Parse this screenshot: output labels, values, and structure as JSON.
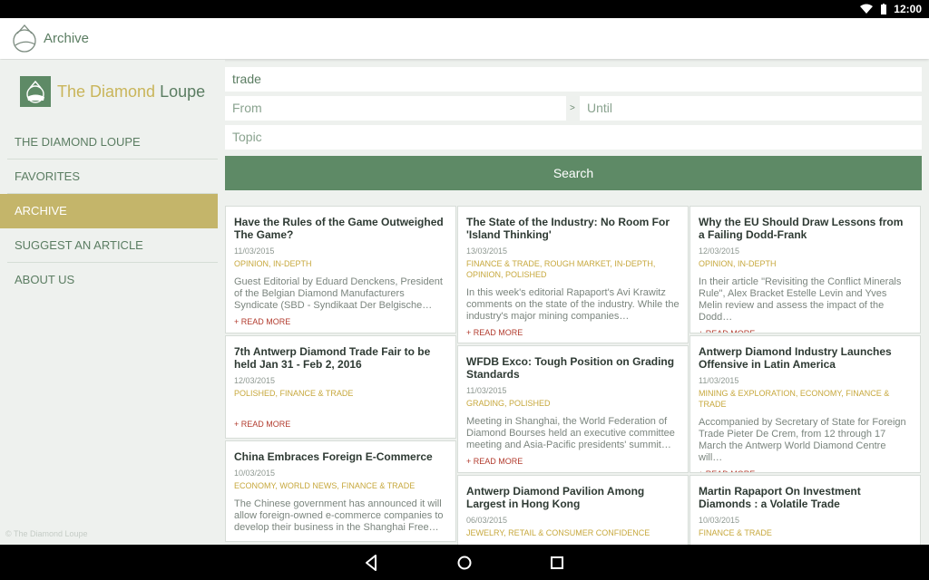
{
  "statusbar": {
    "time": "12:00"
  },
  "appbar": {
    "title": "Archive"
  },
  "brand": {
    "text_part1": "The Diamond ",
    "text_part2": "Loupe"
  },
  "nav": [
    {
      "label": "THE DIAMOND LOUPE"
    },
    {
      "label": "FAVORITES"
    },
    {
      "label": "ARCHIVE"
    },
    {
      "label": "SUGGEST AN ARTICLE"
    },
    {
      "label": "ABOUT US"
    }
  ],
  "copyright": "© The Diamond Loupe",
  "search": {
    "query_value": "trade",
    "from_placeholder": "From",
    "separator": ">",
    "until_placeholder": "Until",
    "topic_placeholder": "Topic",
    "button_label": "Search"
  },
  "read_more": "+ READ MORE",
  "articles": {
    "col1": [
      {
        "title": "Have the Rules of the Game Outweighed The Game?",
        "date": "11/03/2015",
        "tags": "OPINION, IN-DEPTH",
        "excerpt": "Guest Editorial by Eduard Denckens, President of the Belgian Diamond Manufacturers Syndicate (SBD - Syndikaat Der Belgische…"
      },
      {
        "title": "7th Antwerp Diamond Trade Fair to be held Jan 31 - Feb 2, 2016",
        "date": "12/03/2015",
        "tags": "POLISHED, FINANCE & TRADE",
        "excerpt": ""
      },
      {
        "title": "China Embraces Foreign E-Commerce",
        "date": "10/03/2015",
        "tags": "ECONOMY, WORLD NEWS, FINANCE & TRADE",
        "excerpt": "The Chinese government has announced it will allow foreign-owned e-commerce companies to develop their business in the Shanghai Free…"
      }
    ],
    "col2": [
      {
        "title": "The State of the Industry: No Room For 'Island Thinking'",
        "date": "13/03/2015",
        "tags": "FINANCE & TRADE, ROUGH MARKET, IN-DEPTH, OPINION, POLISHED",
        "excerpt": "In this week's editorial Rapaport's Avi Krawitz comments on the state of the industry. While the industry's major mining companies…"
      },
      {
        "title": "WFDB Exco: Tough Position on Grading Standards",
        "date": "11/03/2015",
        "tags": "GRADING, POLISHED",
        "excerpt": "Meeting in Shanghai, the World Federation of Diamond Bourses held an executive committee meeting and Asia-Pacific presidents' summit…"
      },
      {
        "title": "Antwerp Diamond Pavilion Among Largest in Hong Kong",
        "date": "06/03/2015",
        "tags": "JEWELRY, RETAIL & CONSUMER CONFIDENCE",
        "excerpt": ""
      }
    ],
    "col3": [
      {
        "title": "Why the EU Should Draw Lessons from a Failing Dodd-Frank",
        "date": "12/03/2015",
        "tags": "OPINION, IN-DEPTH",
        "excerpt": "In their article \"Revisiting the Conflict Minerals Rule\", Alex Bracket Estelle Levin and Yves Melin review and assess the impact of the Dodd…"
      },
      {
        "title": "Antwerp Diamond Industry Launches Offensive in Latin America",
        "date": "11/03/2015",
        "tags": "MINING & EXPLORATION, ECONOMY, FINANCE & TRADE",
        "excerpt": "Accompanied by Secretary of State for Foreign Trade Pieter De Crem, from 12 through 17 March the Antwerp World Diamond Centre will…"
      },
      {
        "title": "Martin Rapaport On Investment Diamonds : a Volatile Trade",
        "date": "10/03/2015",
        "tags": "FINANCE & TRADE",
        "excerpt": ""
      }
    ]
  }
}
